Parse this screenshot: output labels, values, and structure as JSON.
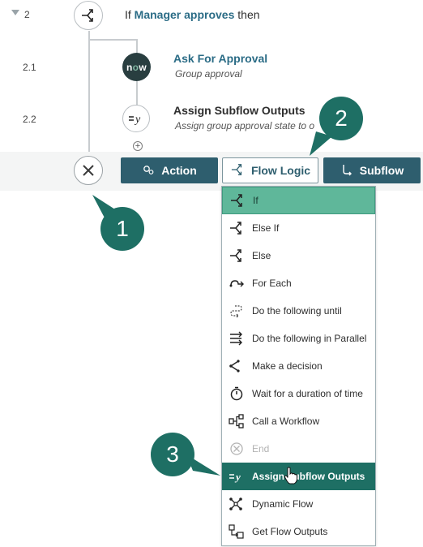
{
  "flow": {
    "step2": {
      "number": "2",
      "prefix": "If ",
      "condition": "Manager approves",
      "suffix": " then"
    },
    "step2_1": {
      "number": "2.1",
      "logo_text_n": "n",
      "logo_text_o": "o",
      "logo_text_w": "w",
      "title": "Ask For Approval",
      "subtitle": "Group approval"
    },
    "step2_2": {
      "number": "2.2",
      "title": "Assign Subflow Outputs",
      "subtitle": "Assign group approval state to o"
    },
    "add_plus": "+"
  },
  "action_bar": {
    "action_label": "Action",
    "flow_logic_label": "Flow Logic",
    "subflow_label": "Subflow"
  },
  "callouts": {
    "one": "1",
    "two": "2",
    "three": "3"
  },
  "menu": {
    "items": [
      {
        "label": "If",
        "icon": "branch-icon"
      },
      {
        "label": "Else If",
        "icon": "branch-icon"
      },
      {
        "label": "Else",
        "icon": "branch-icon"
      },
      {
        "label": "For Each",
        "icon": "for-each-icon"
      },
      {
        "label": "Do the following until",
        "icon": "loop-until-icon"
      },
      {
        "label": "Do the following in Parallel",
        "icon": "parallel-icon"
      },
      {
        "label": "Make a decision",
        "icon": "decision-icon"
      },
      {
        "label": "Wait for a duration of time",
        "icon": "timer-icon"
      },
      {
        "label": "Call a Workflow",
        "icon": "workflow-icon"
      },
      {
        "label": "End",
        "icon": "end-icon"
      },
      {
        "label": "Assign Subflow Outputs",
        "icon": "assign-outputs-icon"
      },
      {
        "label": "Dynamic Flow",
        "icon": "dynamic-flow-icon"
      },
      {
        "label": "Get Flow Outputs",
        "icon": "get-outputs-icon"
      }
    ]
  },
  "colors": {
    "accent": "#2e5e6e",
    "callout": "#1e6f64",
    "hover": "#5fb79a",
    "link": "#2b6c86"
  }
}
